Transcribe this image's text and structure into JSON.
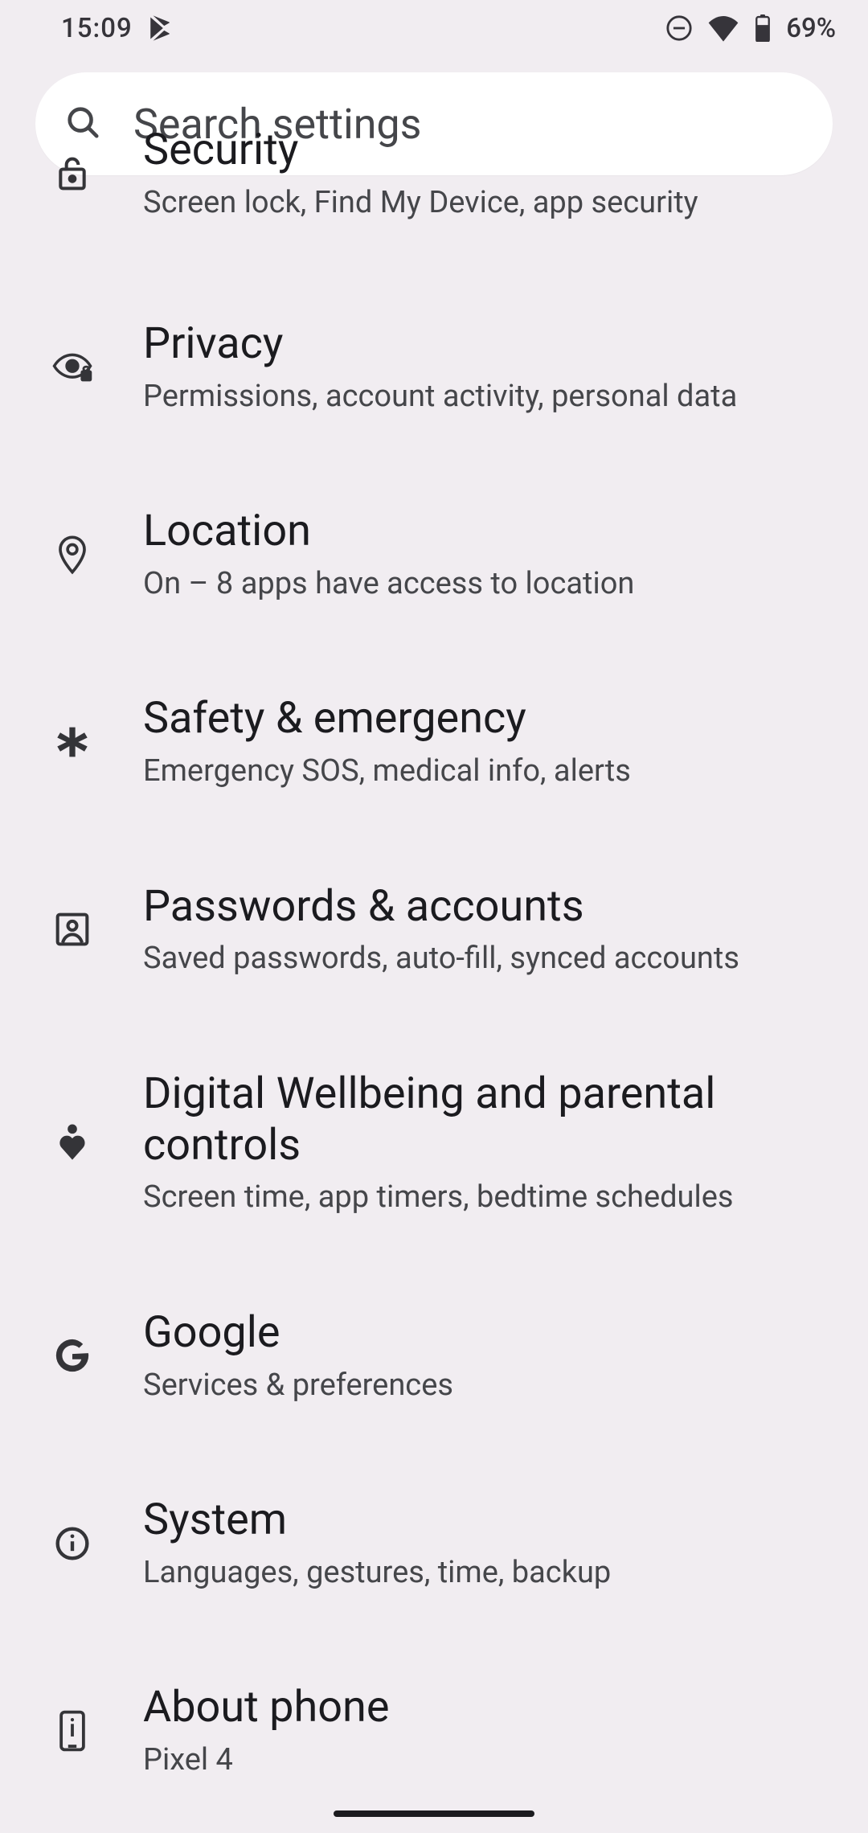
{
  "status": {
    "time": "15:09",
    "battery_pct": "69%"
  },
  "search": {
    "placeholder": "Search settings"
  },
  "settings": [
    {
      "icon": "lock-icon",
      "title": "Security",
      "subtitle": "Screen lock, Find My Device, app security"
    },
    {
      "icon": "privacy-icon",
      "title": "Privacy",
      "subtitle": "Permissions, account activity, personal data"
    },
    {
      "icon": "location-icon",
      "title": "Location",
      "subtitle": "On – 8 apps have access to location"
    },
    {
      "icon": "asterisk-icon",
      "title": "Safety & emergency",
      "subtitle": "Emergency SOS, medical info, alerts"
    },
    {
      "icon": "account-icon",
      "title": "Passwords & accounts",
      "subtitle": "Saved passwords, auto-fill, synced accounts"
    },
    {
      "icon": "wellbeing-icon",
      "title": "Digital Wellbeing and parental controls",
      "subtitle": "Screen time, app timers, bedtime schedules"
    },
    {
      "icon": "google-icon",
      "title": "Google",
      "subtitle": "Services & preferences"
    },
    {
      "icon": "info-icon",
      "title": "System",
      "subtitle": "Languages, gestures, time, backup"
    },
    {
      "icon": "phone-icon",
      "title": "About phone",
      "subtitle": "Pixel 4"
    }
  ]
}
